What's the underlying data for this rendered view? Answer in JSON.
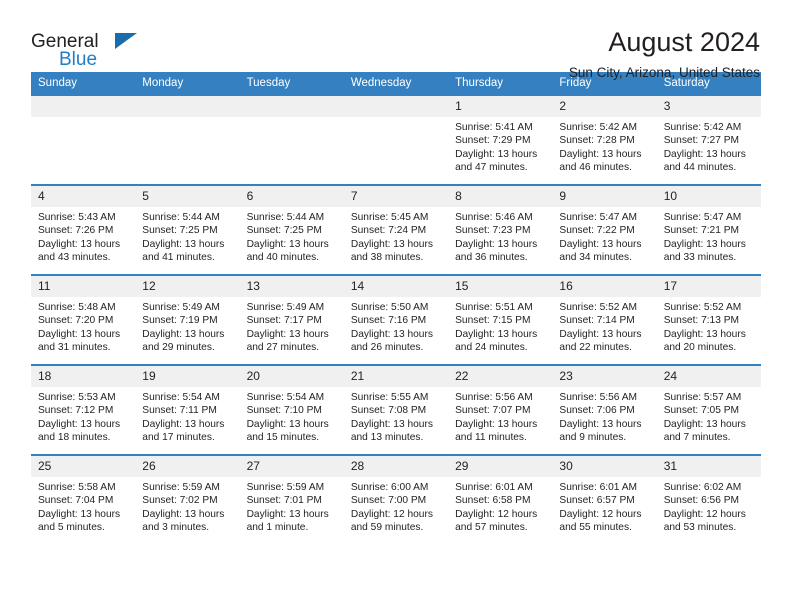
{
  "brand": {
    "line1": "General",
    "line2": "Blue",
    "triangle_color": "#1b6cac"
  },
  "header": {
    "title": "August 2024",
    "subtitle": "Sun City, Arizona, United States"
  },
  "theme": {
    "header_blue": "#3580c0",
    "daynum_gray": "#f0f0f0",
    "text": "#231f20"
  },
  "labels": {
    "sunrise_prefix": "Sunrise:",
    "sunset_prefix": "Sunset:",
    "daylight_prefix": "Daylight:"
  },
  "weekday_headers": [
    "Sunday",
    "Monday",
    "Tuesday",
    "Wednesday",
    "Thursday",
    "Friday",
    "Saturday"
  ],
  "weeks": [
    [
      {
        "day": "",
        "sunrise": "",
        "sunset": "",
        "daylight_line1": "",
        "daylight_line2": ""
      },
      {
        "day": "",
        "sunrise": "",
        "sunset": "",
        "daylight_line1": "",
        "daylight_line2": ""
      },
      {
        "day": "",
        "sunrise": "",
        "sunset": "",
        "daylight_line1": "",
        "daylight_line2": ""
      },
      {
        "day": "",
        "sunrise": "",
        "sunset": "",
        "daylight_line1": "",
        "daylight_line2": ""
      },
      {
        "day": "1",
        "sunrise": "Sunrise: 5:41 AM",
        "sunset": "Sunset: 7:29 PM",
        "daylight_line1": "Daylight: 13 hours",
        "daylight_line2": "and 47 minutes."
      },
      {
        "day": "2",
        "sunrise": "Sunrise: 5:42 AM",
        "sunset": "Sunset: 7:28 PM",
        "daylight_line1": "Daylight: 13 hours",
        "daylight_line2": "and 46 minutes."
      },
      {
        "day": "3",
        "sunrise": "Sunrise: 5:42 AM",
        "sunset": "Sunset: 7:27 PM",
        "daylight_line1": "Daylight: 13 hours",
        "daylight_line2": "and 44 minutes."
      }
    ],
    [
      {
        "day": "4",
        "sunrise": "Sunrise: 5:43 AM",
        "sunset": "Sunset: 7:26 PM",
        "daylight_line1": "Daylight: 13 hours",
        "daylight_line2": "and 43 minutes."
      },
      {
        "day": "5",
        "sunrise": "Sunrise: 5:44 AM",
        "sunset": "Sunset: 7:25 PM",
        "daylight_line1": "Daylight: 13 hours",
        "daylight_line2": "and 41 minutes."
      },
      {
        "day": "6",
        "sunrise": "Sunrise: 5:44 AM",
        "sunset": "Sunset: 7:25 PM",
        "daylight_line1": "Daylight: 13 hours",
        "daylight_line2": "and 40 minutes."
      },
      {
        "day": "7",
        "sunrise": "Sunrise: 5:45 AM",
        "sunset": "Sunset: 7:24 PM",
        "daylight_line1": "Daylight: 13 hours",
        "daylight_line2": "and 38 minutes."
      },
      {
        "day": "8",
        "sunrise": "Sunrise: 5:46 AM",
        "sunset": "Sunset: 7:23 PM",
        "daylight_line1": "Daylight: 13 hours",
        "daylight_line2": "and 36 minutes."
      },
      {
        "day": "9",
        "sunrise": "Sunrise: 5:47 AM",
        "sunset": "Sunset: 7:22 PM",
        "daylight_line1": "Daylight: 13 hours",
        "daylight_line2": "and 34 minutes."
      },
      {
        "day": "10",
        "sunrise": "Sunrise: 5:47 AM",
        "sunset": "Sunset: 7:21 PM",
        "daylight_line1": "Daylight: 13 hours",
        "daylight_line2": "and 33 minutes."
      }
    ],
    [
      {
        "day": "11",
        "sunrise": "Sunrise: 5:48 AM",
        "sunset": "Sunset: 7:20 PM",
        "daylight_line1": "Daylight: 13 hours",
        "daylight_line2": "and 31 minutes."
      },
      {
        "day": "12",
        "sunrise": "Sunrise: 5:49 AM",
        "sunset": "Sunset: 7:19 PM",
        "daylight_line1": "Daylight: 13 hours",
        "daylight_line2": "and 29 minutes."
      },
      {
        "day": "13",
        "sunrise": "Sunrise: 5:49 AM",
        "sunset": "Sunset: 7:17 PM",
        "daylight_line1": "Daylight: 13 hours",
        "daylight_line2": "and 27 minutes."
      },
      {
        "day": "14",
        "sunrise": "Sunrise: 5:50 AM",
        "sunset": "Sunset: 7:16 PM",
        "daylight_line1": "Daylight: 13 hours",
        "daylight_line2": "and 26 minutes."
      },
      {
        "day": "15",
        "sunrise": "Sunrise: 5:51 AM",
        "sunset": "Sunset: 7:15 PM",
        "daylight_line1": "Daylight: 13 hours",
        "daylight_line2": "and 24 minutes."
      },
      {
        "day": "16",
        "sunrise": "Sunrise: 5:52 AM",
        "sunset": "Sunset: 7:14 PM",
        "daylight_line1": "Daylight: 13 hours",
        "daylight_line2": "and 22 minutes."
      },
      {
        "day": "17",
        "sunrise": "Sunrise: 5:52 AM",
        "sunset": "Sunset: 7:13 PM",
        "daylight_line1": "Daylight: 13 hours",
        "daylight_line2": "and 20 minutes."
      }
    ],
    [
      {
        "day": "18",
        "sunrise": "Sunrise: 5:53 AM",
        "sunset": "Sunset: 7:12 PM",
        "daylight_line1": "Daylight: 13 hours",
        "daylight_line2": "and 18 minutes."
      },
      {
        "day": "19",
        "sunrise": "Sunrise: 5:54 AM",
        "sunset": "Sunset: 7:11 PM",
        "daylight_line1": "Daylight: 13 hours",
        "daylight_line2": "and 17 minutes."
      },
      {
        "day": "20",
        "sunrise": "Sunrise: 5:54 AM",
        "sunset": "Sunset: 7:10 PM",
        "daylight_line1": "Daylight: 13 hours",
        "daylight_line2": "and 15 minutes."
      },
      {
        "day": "21",
        "sunrise": "Sunrise: 5:55 AM",
        "sunset": "Sunset: 7:08 PM",
        "daylight_line1": "Daylight: 13 hours",
        "daylight_line2": "and 13 minutes."
      },
      {
        "day": "22",
        "sunrise": "Sunrise: 5:56 AM",
        "sunset": "Sunset: 7:07 PM",
        "daylight_line1": "Daylight: 13 hours",
        "daylight_line2": "and 11 minutes."
      },
      {
        "day": "23",
        "sunrise": "Sunrise: 5:56 AM",
        "sunset": "Sunset: 7:06 PM",
        "daylight_line1": "Daylight: 13 hours",
        "daylight_line2": "and 9 minutes."
      },
      {
        "day": "24",
        "sunrise": "Sunrise: 5:57 AM",
        "sunset": "Sunset: 7:05 PM",
        "daylight_line1": "Daylight: 13 hours",
        "daylight_line2": "and 7 minutes."
      }
    ],
    [
      {
        "day": "25",
        "sunrise": "Sunrise: 5:58 AM",
        "sunset": "Sunset: 7:04 PM",
        "daylight_line1": "Daylight: 13 hours",
        "daylight_line2": "and 5 minutes."
      },
      {
        "day": "26",
        "sunrise": "Sunrise: 5:59 AM",
        "sunset": "Sunset: 7:02 PM",
        "daylight_line1": "Daylight: 13 hours",
        "daylight_line2": "and 3 minutes."
      },
      {
        "day": "27",
        "sunrise": "Sunrise: 5:59 AM",
        "sunset": "Sunset: 7:01 PM",
        "daylight_line1": "Daylight: 13 hours",
        "daylight_line2": "and 1 minute."
      },
      {
        "day": "28",
        "sunrise": "Sunrise: 6:00 AM",
        "sunset": "Sunset: 7:00 PM",
        "daylight_line1": "Daylight: 12 hours",
        "daylight_line2": "and 59 minutes."
      },
      {
        "day": "29",
        "sunrise": "Sunrise: 6:01 AM",
        "sunset": "Sunset: 6:58 PM",
        "daylight_line1": "Daylight: 12 hours",
        "daylight_line2": "and 57 minutes."
      },
      {
        "day": "30",
        "sunrise": "Sunrise: 6:01 AM",
        "sunset": "Sunset: 6:57 PM",
        "daylight_line1": "Daylight: 12 hours",
        "daylight_line2": "and 55 minutes."
      },
      {
        "day": "31",
        "sunrise": "Sunrise: 6:02 AM",
        "sunset": "Sunset: 6:56 PM",
        "daylight_line1": "Daylight: 12 hours",
        "daylight_line2": "and 53 minutes."
      }
    ]
  ]
}
